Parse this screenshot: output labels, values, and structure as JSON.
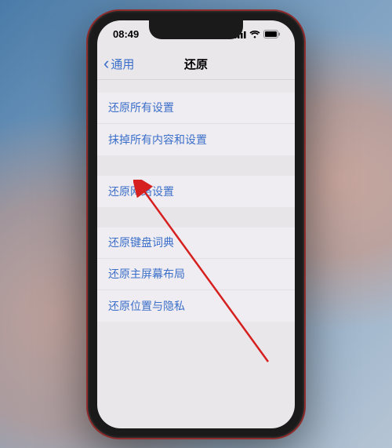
{
  "status": {
    "time": "08:49"
  },
  "nav": {
    "back_label": "通用",
    "title": "还原"
  },
  "groups": [
    {
      "items": [
        {
          "label": "还原所有设置"
        },
        {
          "label": "抹掉所有内容和设置"
        }
      ]
    },
    {
      "items": [
        {
          "label": "还原网络设置"
        }
      ]
    },
    {
      "items": [
        {
          "label": "还原键盘词典"
        },
        {
          "label": "还原主屏幕布局"
        },
        {
          "label": "还原位置与隐私"
        }
      ]
    }
  ],
  "annotation": {
    "target": "还原网络设置"
  }
}
